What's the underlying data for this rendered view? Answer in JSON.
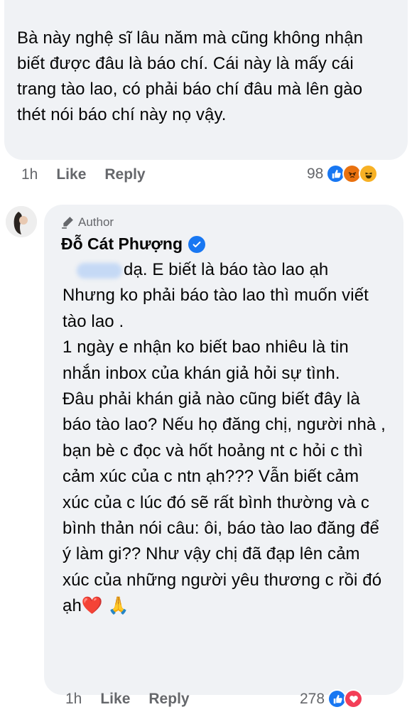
{
  "comment1": {
    "text": "Bà này nghệ sĩ lâu năm mà cũng không nhận biết được đâu là báo chí. Cái này là mấy cái trang tào lao, có phải báo chí đâu mà lên gào thét nói báo chí này nọ vậy.",
    "time": "1h",
    "like_label": "Like",
    "reply_label": "Reply",
    "reaction_count": "98",
    "reactions": [
      "like-icon",
      "angry-icon",
      "haha-icon"
    ]
  },
  "comment2": {
    "author_badge": "Author",
    "author_name": "Đỗ Cát Phượng",
    "text": "dạ. E biết là báo tào lao ạh\nNhưng ko phải báo tào lao thì muốn viết tào lao .\n1 ngày e nhận ko biết bao nhiêu là tin nhắn inbox của khán giả hỏi sự tình.\nĐâu phải khán giả nào cũng biết đây là báo tào lao? Nếu họ đăng chị, người nhà , bạn bè c đọc và hốt hoảng nt c hỏi c thì cảm xúc của c ntn ạh??? Vẫn biết cảm xúc của c lúc đó sẽ rất bình thường và c bình thản nói câu: ôi, báo tào lao đăng để ý làm gi?? Như vậy chị đã đạp lên cảm xúc của những người yêu thương c rồi đó ạh❤️ 🙏",
    "time": "1h",
    "like_label": "Like",
    "reply_label": "Reply",
    "reaction_count": "278",
    "reactions": [
      "like-icon",
      "love-icon"
    ]
  },
  "colors": {
    "bubble": "#f0f2f5",
    "meta": "#65676b",
    "brand": "#1877f2"
  }
}
